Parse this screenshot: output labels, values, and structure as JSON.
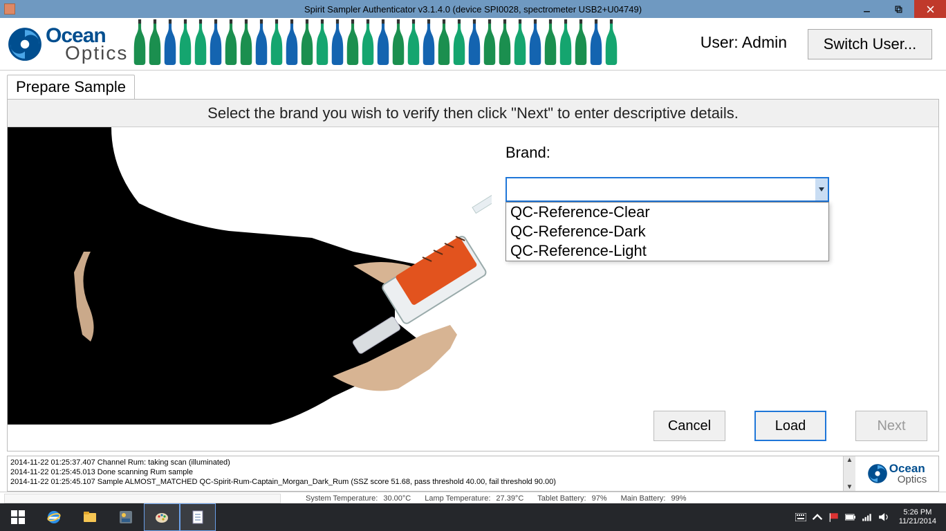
{
  "window": {
    "title": "Spirit Sampler Authenticator v3.1.4.0 (device SPI0028, spectrometer USB2+U04749)"
  },
  "header": {
    "logo_line1": "Ocean",
    "logo_line2": "Optics",
    "user_label": "User: Admin",
    "switch_user": "Switch User..."
  },
  "tab": {
    "label": "Prepare Sample"
  },
  "banner": "Select the brand you wish to verify then click \"Next\" to enter descriptive details.",
  "brand": {
    "label": "Brand:",
    "value": "",
    "options": [
      "QC-Reference-Clear",
      "QC-Reference-Dark",
      "QC-Reference-Light"
    ]
  },
  "buttons": {
    "cancel": "Cancel",
    "load": "Load",
    "next": "Next"
  },
  "log": {
    "lines": [
      "2014-11-22 01:25:37.407 Channel Rum: taking scan (illuminated)",
      "2014-11-22 01:25:45.013 Done scanning Rum sample",
      "2014-11-22 01:25:45.107 Sample ALMOST_MATCHED QC-Spirit-Rum-Captain_Morgan_Dark_Rum (SSZ score 51.68, pass threshold 40.00, fail threshold 90.00)"
    ]
  },
  "status": {
    "sys_temp_lbl": "System Temperature:",
    "sys_temp_val": "30.00°C",
    "lamp_temp_lbl": "Lamp Temperature:",
    "lamp_temp_val": "27.39°C",
    "tablet_batt_lbl": "Tablet Battery:",
    "tablet_batt_val": "97%",
    "main_batt_lbl": "Main Battery:",
    "main_batt_val": "99%"
  },
  "tray": {
    "time": "5:26 PM",
    "date": "11/21/2014"
  },
  "bottle_colors": [
    "#1b8f4f",
    "#1b8f4f",
    "#1464b0",
    "#15a56f",
    "#15a56f",
    "#1464b0",
    "#1b8f4f",
    "#1b8f4f",
    "#1464b0",
    "#15a56f",
    "#1464b0",
    "#1b8f4f",
    "#15a56f",
    "#1464b0",
    "#1b8f4f",
    "#15a56f",
    "#1464b0",
    "#1b8f4f",
    "#15a56f",
    "#1464b0",
    "#1b8f4f",
    "#15a56f",
    "#1464b0",
    "#1b8f4f",
    "#1b8f4f",
    "#15a56f",
    "#1464b0",
    "#1b8f4f",
    "#15a56f",
    "#1b8f4f",
    "#1464b0",
    "#15a56f"
  ]
}
